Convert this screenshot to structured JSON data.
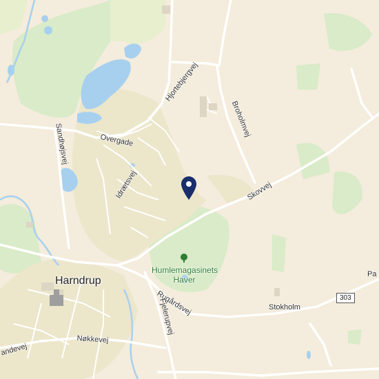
{
  "labels": {
    "harndrup": "Harndrup",
    "overgade": "Overgade",
    "idraetsvej": "Idrætsvej",
    "hjortebjergvej": "Hjortebjergvej",
    "broholmvej": "Broholmvej",
    "skovvej": "Skovvej",
    "sandhojsvej": "Sandhøjsvej",
    "rugardsvej": "Rugårdsvej",
    "fjelerupvej": "Fjelerupvej",
    "stokholm": "Stokholm",
    "nokkevej": "Nøkkevej",
    "andevej": "andevej",
    "poi_line1": "Humlemagasinets",
    "poi_line2": "Haver",
    "pa": "Pa",
    "route": "303"
  },
  "icons": {
    "marker": "location-pin-icon",
    "poi": "tree-icon"
  },
  "colors": {
    "land": "#f4ecdc",
    "forest": "#d9ebc8",
    "water": "#a7d0ef",
    "urban": "#ece6cb",
    "road": "#ffffff",
    "marker": "#1a2e6b",
    "poi": "#2e7d32"
  }
}
